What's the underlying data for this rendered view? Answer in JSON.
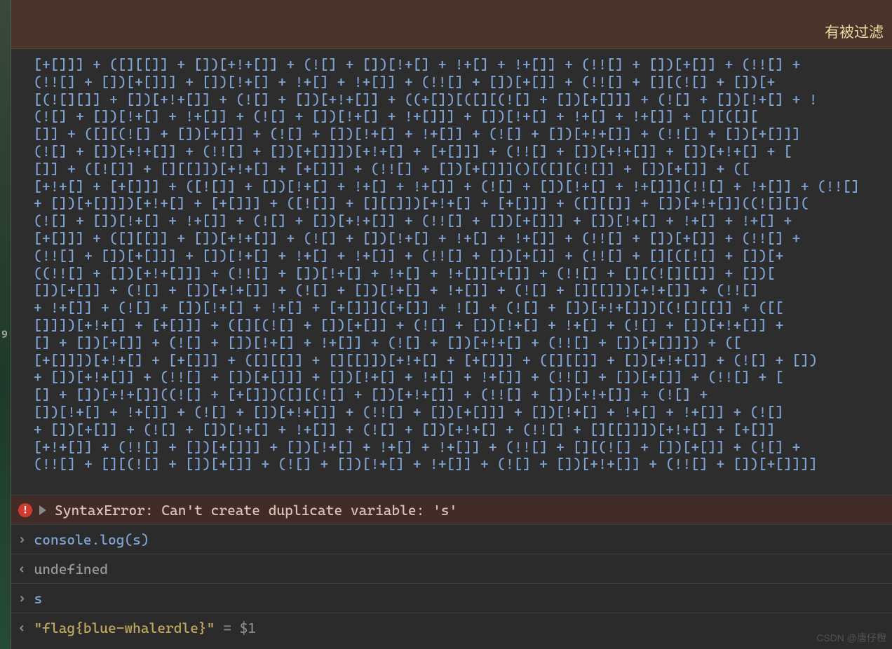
{
  "left_strip": {
    "line_number": "9"
  },
  "banner": {
    "text": "有被过滤"
  },
  "jsfuck_code": "[+[]]] + ([][[]] + [])[+!+[]] + (![] + [])[!+[] + !+[] + !+[]] + (!![] + [])[+[]] + (!![] +\n(!![] + [])[+[]]] + [])[!+[] + !+[] + !+[]] + (!![] + [])[+[]] + (!![] + [][(![] + [])[+\n[(![][]] + [])[+!+[]] + (![] + [])[+!+[]] + ((+[])[([][(![] + [])[+[]]] + (![] + [])[!+[] + !\n(![] + [])[!+[] + !+[]] + (![] + [])[!+[] + !+[]]] + [])[!+[] + !+[] + !+[]] + [][([][\n[]] + ([][(![] + [])[+[]] + (![] + [])[!+[] + !+[]] + (![] + [])[+!+[]] + (!![] + [])[+[]]]\n(![] + [])[+!+[]] + (!![] + [])[+[]]])[+!+[] + [+[]]] + (!![] + [])[+!+[]] + [])[+!+[] + [\n[]] + ([![]] + [][[]])[+!+[] + [+[]]] + (!![] + [])[+[]]]()[([][(![]] + [])[+[]] + ([\n[+!+[] + [+[]]] + ([![]] + [])[!+[] + !+[] + !+[]] + (![] + [])[!+[] + !+[]]](!![] + !+[]] + (!![]\n+ [])[+[]]])[+!+[] + [+[]]] + ([![]] + [][[]])[+!+[] + [+[]]] + ([][[]] + [])[+!+[]]((![][](\n(![] + [])[!+[] + !+[]] + (![] + [])[+!+[]] + (!![] + [])[+[]]] + [])[!+[] + !+[] + !+[] +\n[+[]]] + ([][[]] + [])[+!+[]] + (![] + [])[!+[] + !+[] + !+[]] + (!![] + [])[+[]] + (!![] +\n(!![] + [])[+[]]] + [])[!+[] + !+[] + !+[]] + (!![] + [])[+[]] + (!![] + [][([![] + [])[+\n((!![] + [])[+!+[]]] + (!![] + [])[!+[] + !+[] + !+[]][+[]] + (!![] + [][(![][[]] + [])[\n[])[+[]] + (![] + [])[+!+[]] + (![] + [])[!+[] + !+[]] + (![] + [][[]])[+!+[]] + (!![]\n+ !+[]] + (![] + [])[!+[] + !+[] + [+[]]]([+[]] + ![] + (![] + [])[+!+[]])[(![][[]] + ([[\n[]]])[+!+[] + [+[]]] + ([][(![] + [])[+[]] + (![] + [])[!+[] + !+[] + (![] + [])[+!+[]] +\n[] + [])[+[]] + (![] + [])[!+[] + !+[]] + (![] + [])[+!+[] + (!![] + [])[+[]]]) + ([\n[+[]]])[+!+[] + [+[]]] + ([][[]] + [][[]])[+!+[] + [+[]]] + ([][[]] + [])[+!+[]] + (![] + [])\n+ [])[+!+[]] + (!![] + [])[+[]]] + [])[!+[] + !+[] + !+[]] + (!![] + [])[+[]] + (!![] + [\n[] + [])[+!+[]]((![] + [+[]])([][(![] + [])[+!+[]] + (!![] + [])[+!+[]] + (![] +\n[])[!+[] + !+[]] + (![] + [])[+!+[]] + (!![] + [])[+[]]] + [])[!+[] + !+[] + !+[]] + (![]\n+ [])[+[]] + (![] + [])[!+[] + !+[]] + (![] + [])[+!+[] + (!![] + [][[]]])[+!+[] + [+[]]\n[+!+[]] + (!![] + [])[+[]]] + [])[!+[] + !+[] + !+[]] + (!![] + [][(![] + [])[+[]] + (![] +\n(!![] + [][(![] + [])[+[]] + (![] + [])[!+[] + !+[]] + (![] + [])[+!+[]] + (!![] + [])[+[]]]]",
  "console": {
    "error_message": "SyntaxError: Can't create duplicate variable: 's'",
    "input1": "console.log(s)",
    "output1": "undefined",
    "input2": "s",
    "output2_string": "\"flag{blue-whalerdle}\"",
    "output2_suffix": "= $1"
  },
  "watermark": "CSDN @唐仔橙"
}
